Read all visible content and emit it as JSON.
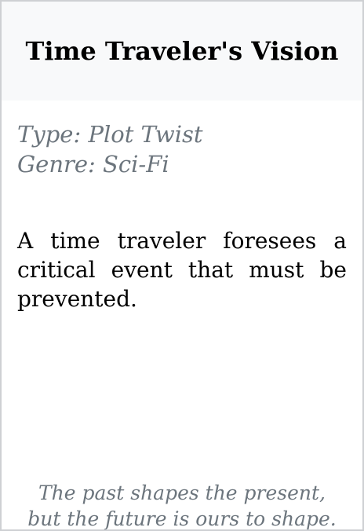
{
  "card": {
    "title": "Time Traveler's Vision",
    "type_line": "Type: Plot Twist",
    "genre_line": "Genre: Sci-Fi",
    "description": "A time traveler foresees a critical event that must be prevented.",
    "quote_line1": "The past shapes the present,",
    "quote_line2": "but the future is ours to shape."
  }
}
